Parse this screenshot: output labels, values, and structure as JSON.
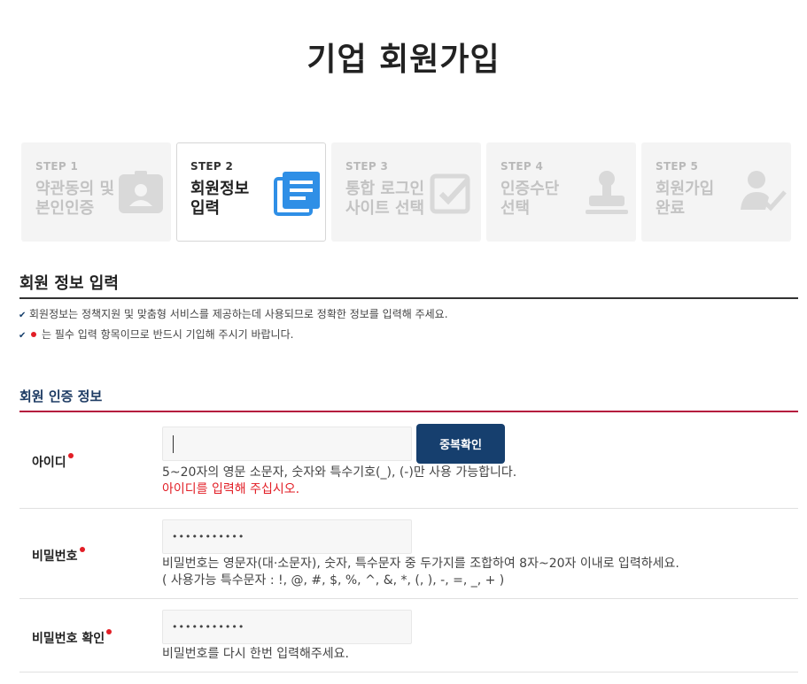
{
  "title": "기업 회원가입",
  "steps": [
    {
      "num": "STEP 1",
      "line1": "약관동의 및",
      "line2": "본인인증",
      "icon": "id-card-icon",
      "active": false
    },
    {
      "num": "STEP 2",
      "line1": "회원정보",
      "line2": "입력",
      "icon": "document-list-icon",
      "active": true
    },
    {
      "num": "STEP 3",
      "line1": "통합 로그인",
      "line2": "사이트 선택",
      "icon": "checkbox-icon",
      "active": false
    },
    {
      "num": "STEP 4",
      "line1": "인증수단",
      "line2": "선택",
      "icon": "stamp-icon",
      "active": false
    },
    {
      "num": "STEP 5",
      "line1": "회원가입",
      "line2": "완료",
      "icon": "user-check-icon",
      "active": false
    }
  ],
  "section": {
    "title": "회원 정보 입력",
    "notices": [
      "회원정보는 정책지원 및 맞춤형 서비스를 제공하는데 사용되므로 정확한 정보를 입력해 주세요.",
      "는 필수 입력 항목이므로 반드시 기입해 주시기 바랍니다."
    ]
  },
  "auth": {
    "title": "회원 인증 정보",
    "id": {
      "label": "아이디",
      "value": "",
      "button": "중복확인",
      "help": "5~20자의 영문 소문자, 숫자와 특수기호(_), (-)만 사용 가능합니다.",
      "error": "아이디를 입력해 주십시오."
    },
    "password": {
      "label": "비밀번호",
      "value": "•••••••••••",
      "help1": "비밀번호는 영문자(대·소문자), 숫자, 특수문자 중 두가지를 조합하여 8자~20자 이내로 입력하세요.",
      "help2": "( 사용가능 특수문자 : !, @, #, $, %, ^, &, *, (, ), -, =, _, + )"
    },
    "password_confirm": {
      "label": "비밀번호 확인",
      "value": "•••••••••••",
      "help": "비밀번호를 다시 한번 입력해주세요."
    }
  },
  "colors": {
    "accent_blue": "#2f8fe6",
    "button_navy": "#163f6e",
    "required_red": "#e21e26",
    "rule_crimson": "#b5163d"
  }
}
